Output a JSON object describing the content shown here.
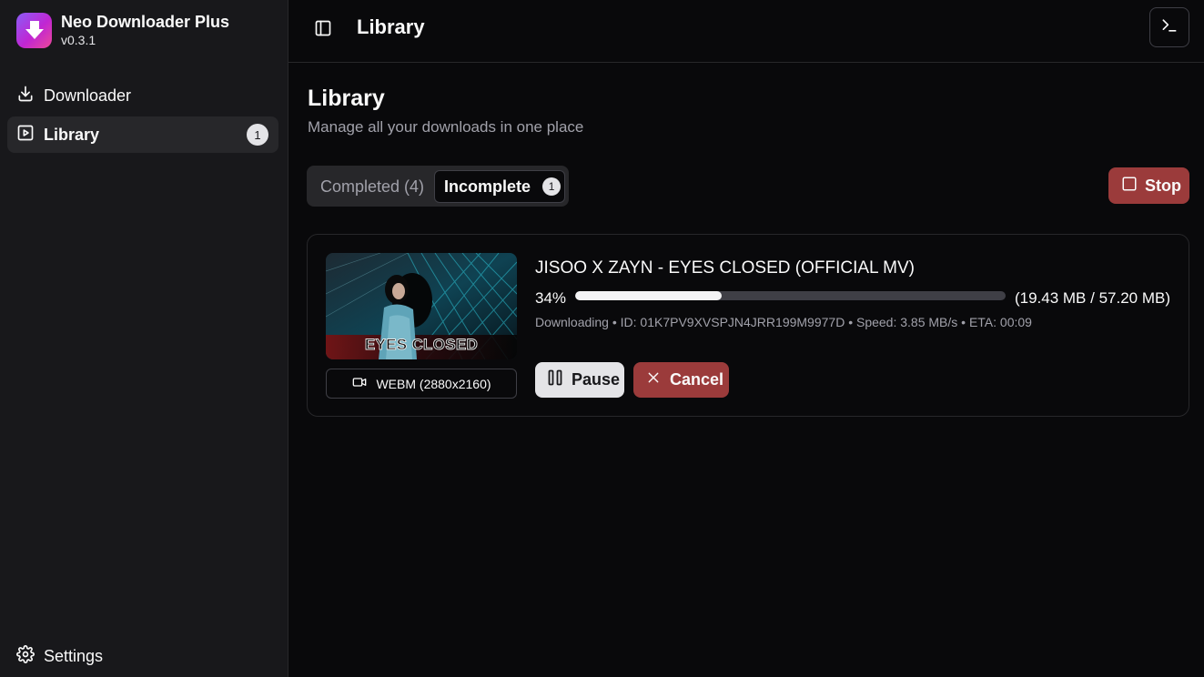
{
  "app": {
    "name": "Neo Downloader Plus",
    "version": "v0.3.1"
  },
  "sidebar": {
    "items": [
      {
        "label": "Downloader",
        "icon": "download-icon"
      },
      {
        "label": "Library",
        "icon": "video-library-icon",
        "badge": "1",
        "active": true
      }
    ],
    "settings_label": "Settings"
  },
  "topbar": {
    "title": "Library"
  },
  "page": {
    "title": "Library",
    "subtitle": "Manage all your downloads in one place"
  },
  "tabs": [
    {
      "label": "Completed (4)"
    },
    {
      "label": "Incomplete",
      "badge": "1",
      "active": true
    }
  ],
  "stop_button": {
    "label": "Stop"
  },
  "download": {
    "title": "JISOO X ZAYN - EYES CLOSED (OFFICIAL MV)",
    "thumbnail_text": "EYES CLOSED",
    "format": "WEBM (2880x2160)",
    "percent_label": "34%",
    "progress": 0.34,
    "size": "(19.43 MB / 57.20 MB)",
    "status_line": "Downloading • ID: 01K7PV9XVSPJN4JRR199M9977D • Speed: 3.85 MB/s • ETA: 00:09",
    "pause_label": "Pause",
    "cancel_label": "Cancel"
  },
  "colors": {
    "background": "#09090b",
    "sidebar": "#18181b",
    "danger": "#9b3b3b",
    "accent_gradient_start": "#8b5cf6",
    "accent_gradient_end": "#ec4899"
  }
}
